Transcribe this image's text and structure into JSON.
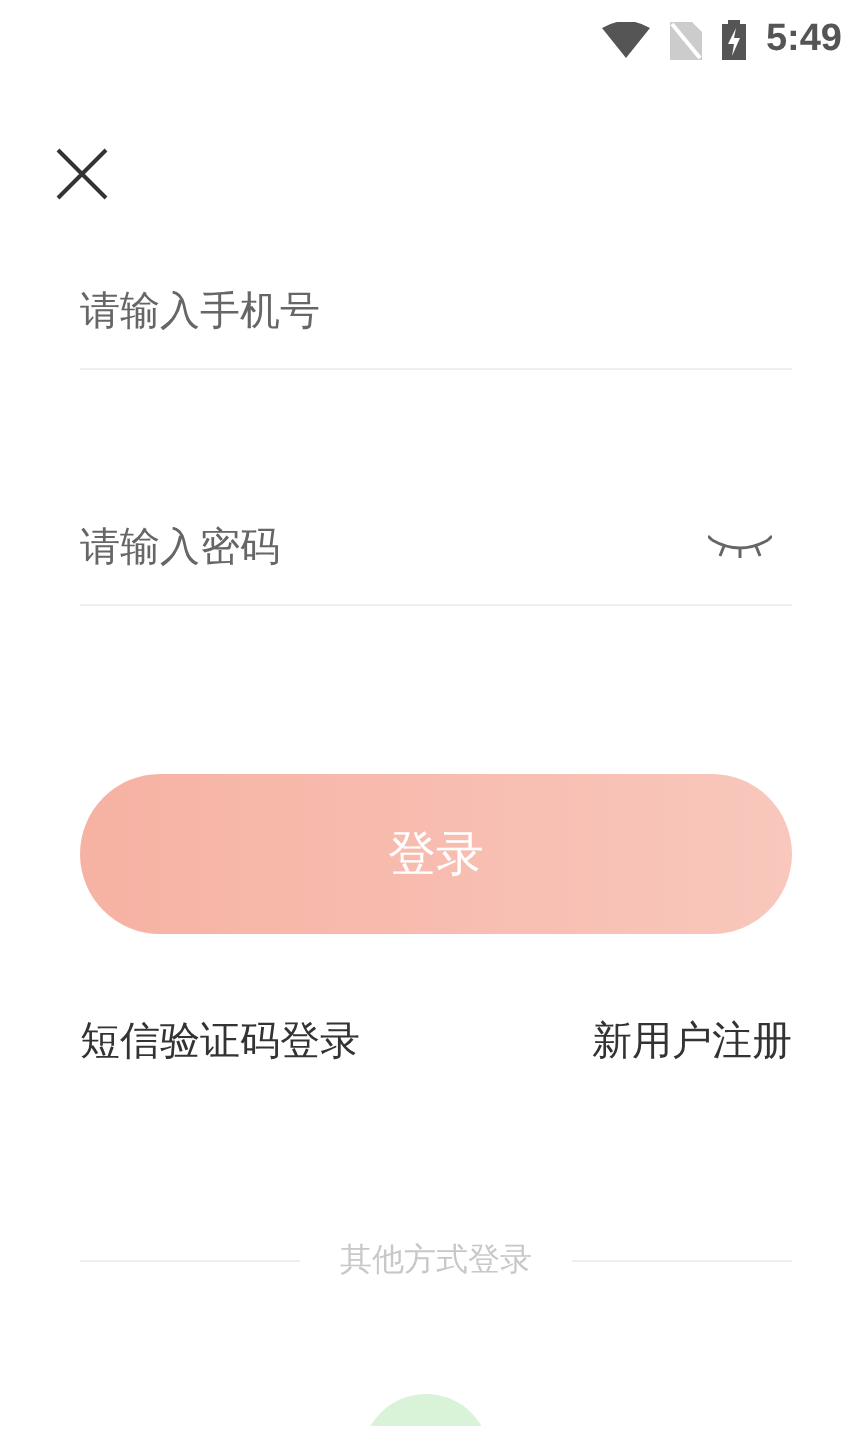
{
  "status_bar": {
    "time": "5:49"
  },
  "phone_field": {
    "placeholder": "请输入手机号"
  },
  "password_field": {
    "placeholder": "请输入密码",
    "visible": false
  },
  "login_button": {
    "label": "登录"
  },
  "links": [
    "短信验证码登录",
    "新用户注册"
  ],
  "other_login": {
    "label": "其他方式登录"
  }
}
